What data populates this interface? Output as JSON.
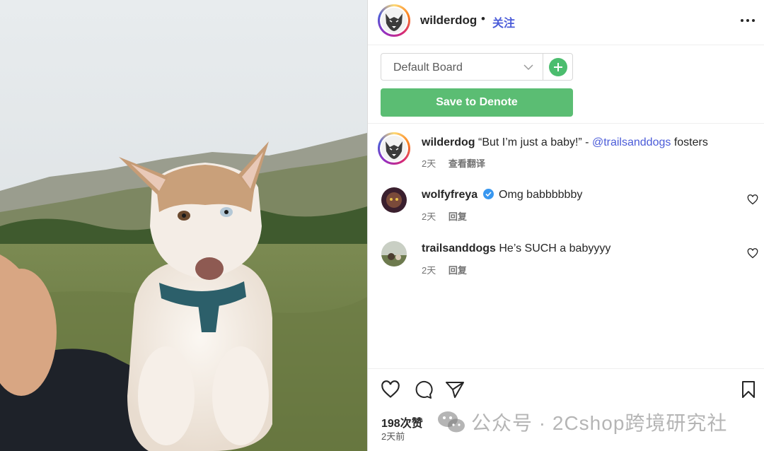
{
  "post": {
    "image_alt": "Husky puppy held by a smiling woman in a mountain meadow",
    "username": "wilderdog",
    "separator": "•",
    "follow_label": "关注"
  },
  "board": {
    "selected": "Default Board",
    "save_label": "Save to Denote"
  },
  "caption": {
    "username": "wilderdog",
    "text_before": "“But I’m just a baby!” - ",
    "mention": "@trailsanddogs",
    "text_after": " fosters",
    "time": "2天",
    "translate_label": "查看翻译"
  },
  "comments": [
    {
      "username": "wolfyfreya",
      "verified": true,
      "text": "Omg babbbbbby",
      "time": "2天",
      "reply_label": "回复"
    },
    {
      "username": "trailsanddogs",
      "verified": false,
      "text": "He’s SUCH a babyyyy",
      "time": "2天",
      "reply_label": "回复"
    }
  ],
  "stats": {
    "likes": "198次赞",
    "time_ago": "2天前"
  },
  "watermark": {
    "text": "公众号 · 2Cshop跨境研究社"
  },
  "icons": {
    "more": "more-horizontal-icon",
    "chevron": "chevron-down-icon",
    "add": "plus-icon",
    "like": "heart-icon",
    "comment": "comment-bubble-icon",
    "share": "paper-plane-icon",
    "save": "bookmark-icon"
  },
  "colors": {
    "link_blue": "#4a5bd8",
    "save_green": "#5bbd73",
    "add_green": "#4bbd6e",
    "verified_blue": "#3897f0"
  }
}
